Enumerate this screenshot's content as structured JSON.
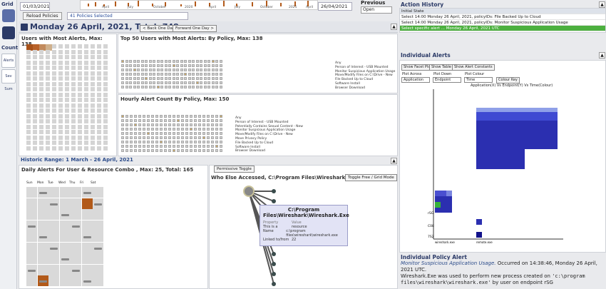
{
  "rail": {
    "grid_label": "Grid",
    "count_label": "Count",
    "alerts_btn": "Alerts",
    "sevsum_btn": "Sev Sum"
  },
  "top": {
    "date_from": "01/03/2021",
    "date_to": "26/04/2021",
    "timeline_years": [
      "April",
      "July",
      "October",
      "2020",
      "April",
      "July",
      "October",
      "2021",
      "April"
    ],
    "reload_label": "Reload Policies",
    "policies_selected": "41 Policies Selected",
    "previous_label": "Previous",
    "previous_value": "Open"
  },
  "header": {
    "date": "Monday 26 April, 2021,",
    "total_label": "Total:",
    "total": "748"
  },
  "panels": {
    "users_title": "Users with Most Alerts, Max: 138",
    "top50_title": "Top 50 Users with Most Alerts: By Policy, Max: 138",
    "hourly_title": "Hourly Alert Count By Policy, Max: 150",
    "back_btn": "< Back One Day",
    "fwd_btn": "Forward One Day >",
    "policies_top": [
      "Any",
      "Person of Interest - USB Mounted",
      "Monitor Suspicious Application Usage",
      "Move/Modify Files on C:\\Drive - New",
      "File Backed Up to Cloud",
      "Software Install",
      "Browser Download"
    ],
    "policies_hourly": [
      "Any",
      "Person of Interest - USB Mounted",
      "Potentially Contains Sexual Content - New",
      "Monitor Suspicious Application Usage",
      "Move/Modify Files on C:\\Drive - New",
      "Move Privacy Policy",
      "File Backed Up to Cloud",
      "Software Install",
      "Browser Download"
    ]
  },
  "range": {
    "label": "Historic Range: 1 March - 26 April, 2021"
  },
  "daily": {
    "title": "Daily Alerts For User & Resource Combo",
    "stats": ", Max: 25, Total: 165",
    "weekdays": [
      "Sun",
      "Mon",
      "Tue",
      "Wed",
      "Thu",
      "Fri",
      "Sat"
    ]
  },
  "who": {
    "permissive_btn": "Permissive Toggle",
    "title": "Who Else Accessed, C:\\Program Files\\Wireshark\\Wireshark.Exe",
    "toggle_btn": "Toggle Free / Grid Mode",
    "tooltip_title": "C:\\Program Files\\Wireshark\\Wireshark.Exe",
    "tt_prop": "Property",
    "tt_val": "Value",
    "tt_rows": [
      [
        "This is a",
        "resource"
      ],
      [
        "Name",
        "c:\\program files\\wireshark\\wireshark.exe"
      ],
      [
        "Linked to/from",
        "22"
      ]
    ]
  },
  "history": {
    "title": "Action History",
    "rows": [
      "Initial State",
      "Select 14:00 Monday 26 April, 2021, policyIDs: File Backed Up to Cloud",
      "Select 14:00 Monday 26 April, 2021, policyIDs: Monitor Suspicious Application Usage",
      "Select specific alert ... Monday 26 April, 2021 UTC"
    ]
  },
  "individual": {
    "title": "Individual Alerts",
    "tabs": [
      "Show Facet Plot",
      "Show Table",
      "Show Alert Constants"
    ],
    "dd_labels": [
      "Plot Across",
      "Plot Down",
      "Plot Colour"
    ],
    "dd_values": [
      "Application",
      "Endpoint",
      "Time"
    ],
    "colour_key": "Colour Key",
    "chart_title": "Application(X) Vs Endpoint(Y) Vs Time(Colour)",
    "y_ticks": [
      "rSG",
      "C08",
      "7S2"
    ],
    "x_ticks": [
      "wireshark.exe",
      "remote.exe"
    ]
  },
  "policy_alert": {
    "title": "Individual Policy Alert",
    "policy": "Monitor Suspicious Application Usage.",
    "occurred": "Occurred on 14:38:46, Monday 26 April, 2021 UTC.",
    "line2a": "Wireshark.Exe was used to perform new process created on",
    "path": "'c:\\program files\\wireshark\\wireshark.exe'",
    "line3a": "by user",
    "line3b": "on endpoint rSG"
  },
  "colors": {
    "accent": "#2b3a67",
    "alert": "#b25a1a",
    "select": "#4cb03f",
    "heat": "#2b2fb0"
  }
}
